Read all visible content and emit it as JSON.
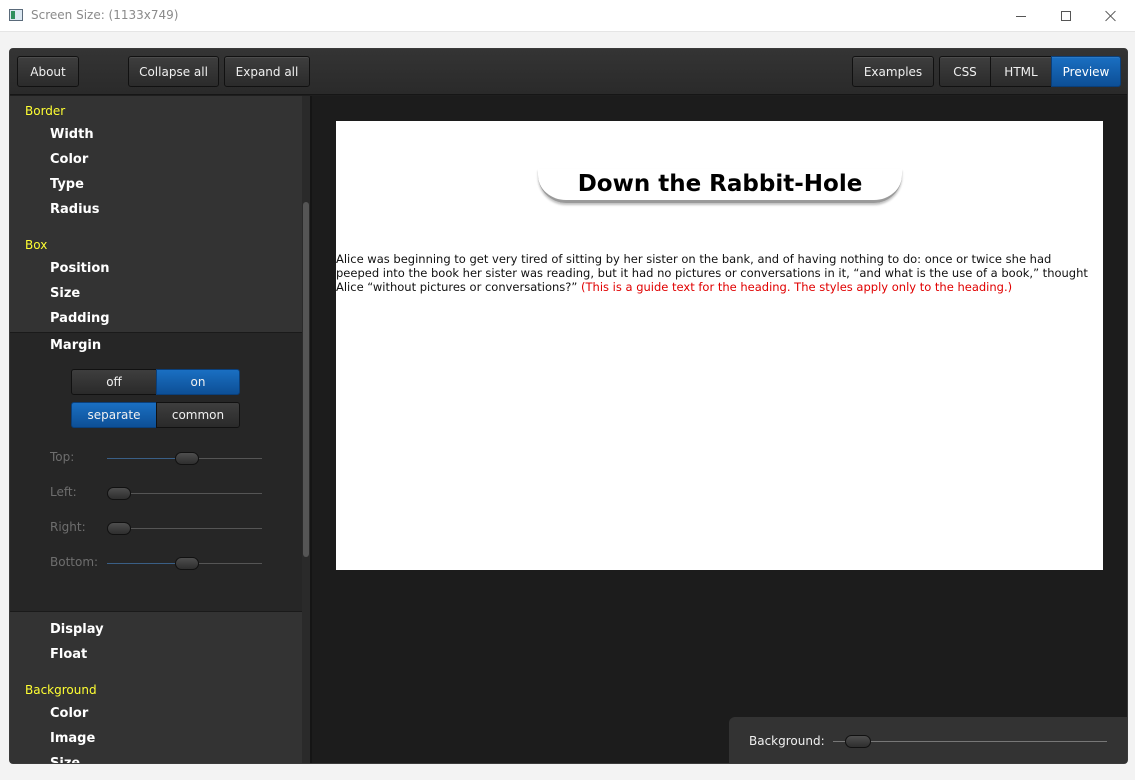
{
  "window": {
    "title": "Screen Size: (1133x749)"
  },
  "toolbar": {
    "about": "About",
    "collapse_all": "Collapse all",
    "expand_all": "Expand all",
    "examples": "Examples",
    "css": "CSS",
    "html": "HTML",
    "preview": "Preview",
    "active_view": "Preview"
  },
  "sidebar": {
    "border": {
      "heading": "Border",
      "items": [
        "Width",
        "Color",
        "Type",
        "Radius"
      ]
    },
    "box": {
      "heading": "Box",
      "items": [
        "Position",
        "Size",
        "Padding",
        "Margin",
        "Display",
        "Float"
      ]
    },
    "background": {
      "heading": "Background",
      "items": [
        "Color",
        "Image",
        "Size"
      ]
    }
  },
  "margin": {
    "off": "off",
    "on": "on",
    "onoff_selected": "on",
    "separate": "separate",
    "common": "common",
    "mode_selected": "separate",
    "sliders": [
      {
        "label": "Top:",
        "value": 0.52
      },
      {
        "label": "Left:",
        "value": 0.0
      },
      {
        "label": "Right:",
        "value": 0.0
      },
      {
        "label": "Bottom:",
        "value": 0.52
      }
    ]
  },
  "preview": {
    "heading": "Down the Rabbit-Hole",
    "paragraph": "Alice was beginning to get very tired of sitting by her sister on the bank, and of having nothing to do: once or twice she had peeped into the book her sister was reading, but it had no pictures or conversations in it, “and what is the use of a book,” thought Alice “without pictures or conversations?”",
    "guide": "(This is a guide text for the heading. The styles apply only to the heading.)",
    "guide_color": "#e00000"
  },
  "background_control": {
    "label": "Background:",
    "value": 0.05
  },
  "colors": {
    "accent": "#1560b0",
    "section_heading": "#ffff33"
  }
}
